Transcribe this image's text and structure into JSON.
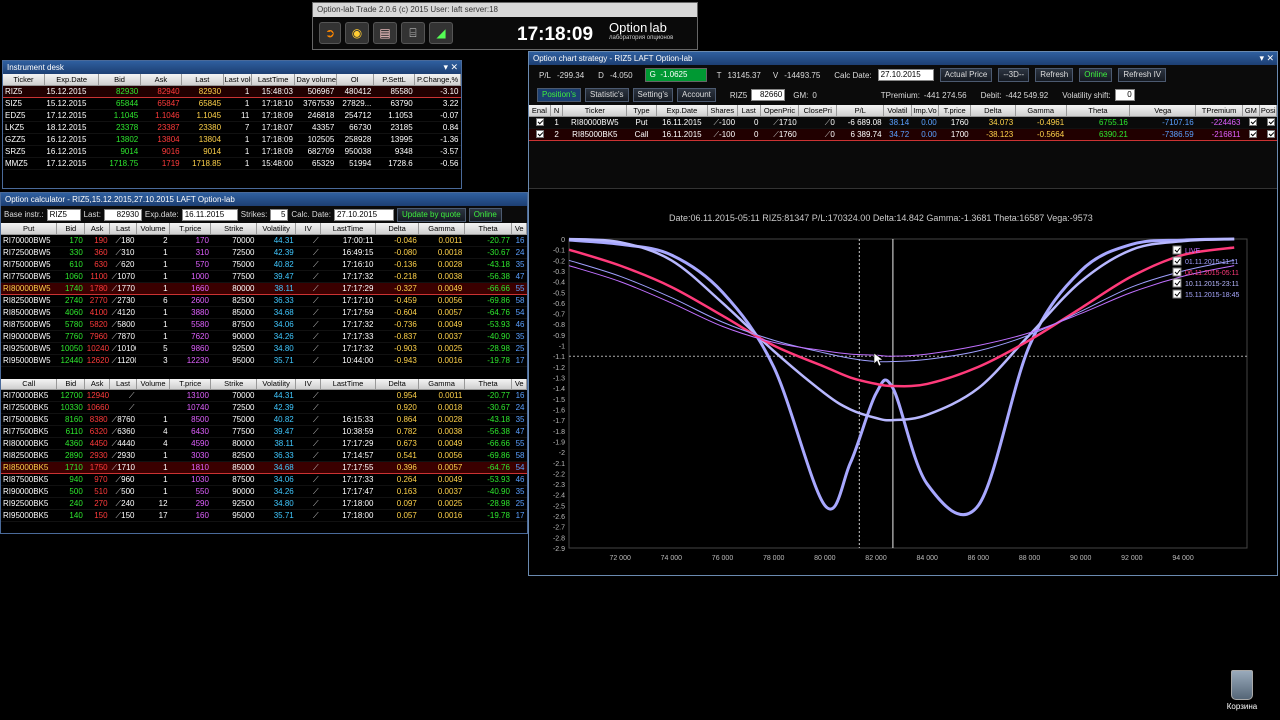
{
  "toolbar": {
    "title": "Option-lab Trade 2.0.6 (c) 2015 User: laft server:18",
    "clock": "17:18:09",
    "logo_main": "Option",
    "logo_lab": "lab",
    "logo_sub": "лаборатория опционов"
  },
  "desk": {
    "title": "Instrument desk",
    "headers": [
      "Ticker",
      "Exp.Date",
      "Bid",
      "Ask",
      "Last",
      "Last volume",
      "LastTime",
      "Day volume",
      "OI",
      "P.SettL",
      "P.Change,%"
    ],
    "rows": [
      [
        "RIZ5",
        "15.12.2015",
        "82930",
        "82940",
        "82930",
        "1",
        "15:48:03",
        "506967",
        "480412",
        "85580",
        "-3.10"
      ],
      [
        "SIZ5",
        "15.12.2015",
        "65844",
        "65847",
        "65845",
        "1",
        "17:18:10",
        "3767539",
        "27829...",
        "63790",
        "3.22"
      ],
      [
        "EDZ5",
        "17.12.2015",
        "1.1045",
        "1.1046",
        "1.1045",
        "11",
        "17:18:09",
        "246818",
        "254712",
        "1.1053",
        "-0.07"
      ],
      [
        "LKZ5",
        "18.12.2015",
        "23378",
        "23387",
        "23380",
        "7",
        "17:18:07",
        "43357",
        "66730",
        "23185",
        "0.84"
      ],
      [
        "GZZ5",
        "16.12.2015",
        "13802",
        "13804",
        "13804",
        "1",
        "17:18:09",
        "102505",
        "258928",
        "13995",
        "-1.36"
      ],
      [
        "SRZ5",
        "16.12.2015",
        "9014",
        "9016",
        "9014",
        "1",
        "17:18:09",
        "682709",
        "950038",
        "9348",
        "-3.57"
      ],
      [
        "MMZ5",
        "17.12.2015",
        "1718.75",
        "1719",
        "1718.85",
        "1",
        "15:48:00",
        "65329",
        "51994",
        "1728.6",
        "-0.56"
      ]
    ]
  },
  "calc": {
    "title": "Option calculator - RIZ5,15.12.2015,27.10.2015 LAFT Option-lab",
    "base_label": "Base instr.:",
    "base_value": "RIZ5",
    "last_label": "Last:",
    "last_value": "82930",
    "exp_label": "Exp.date:",
    "exp_value": "16.11.2015",
    "strikes_label": "Strikes:",
    "strikes_value": "5",
    "calcdate_label": "Calc. Date:",
    "calcdate_value": "27.10.2015",
    "update_btn": "Update by quote",
    "online_btn": "Online",
    "put_headers": [
      "Put",
      "Bid",
      "Ask",
      "Last",
      "Volume",
      "T.price",
      "Strike",
      "Volatility",
      "IV",
      "LastTime",
      "Delta",
      "Gamma",
      "Theta",
      "Ve"
    ],
    "put_rows": [
      [
        "RI70000BW5",
        "170",
        "190",
        "180",
        "2",
        "170",
        "70000",
        "44.31",
        "",
        "17:00:11",
        "-0.046",
        "0.0011",
        "-20.77",
        "16"
      ],
      [
        "RI72500BW5",
        "330",
        "360",
        "310",
        "1",
        "310",
        "72500",
        "42.39",
        "",
        "16:49:15",
        "-0.080",
        "0.0018",
        "-30.67",
        "24"
      ],
      [
        "RI75000BW5",
        "610",
        "630",
        "620",
        "1",
        "570",
        "75000",
        "40.82",
        "",
        "17:16:10",
        "-0.136",
        "0.0028",
        "-43.18",
        "35"
      ],
      [
        "RI77500BW5",
        "1060",
        "1100",
        "1070",
        "1",
        "1000",
        "77500",
        "39.47",
        "",
        "17:17:32",
        "-0.218",
        "0.0038",
        "-56.38",
        "47"
      ],
      [
        "RI80000BW5",
        "1740",
        "1780",
        "1770",
        "1",
        "1660",
        "80000",
        "38.11",
        "",
        "17:17:29",
        "-0.327",
        "0.0049",
        "-66.66",
        "55"
      ],
      [
        "RI82500BW5",
        "2740",
        "2770",
        "2730",
        "6",
        "2600",
        "82500",
        "36.33",
        "",
        "17:17:10",
        "-0.459",
        "0.0056",
        "-69.86",
        "58"
      ],
      [
        "RI85000BW5",
        "4060",
        "4100",
        "4120",
        "1",
        "3880",
        "85000",
        "34.68",
        "",
        "17:17:59",
        "-0.604",
        "0.0057",
        "-64.76",
        "54"
      ],
      [
        "RI87500BW5",
        "5780",
        "5820",
        "5800",
        "1",
        "5580",
        "87500",
        "34.06",
        "",
        "17:17:32",
        "-0.736",
        "0.0049",
        "-53.93",
        "46"
      ],
      [
        "RI90000BW5",
        "7760",
        "7960",
        "7870",
        "1",
        "7620",
        "90000",
        "34.26",
        "",
        "17:17:33",
        "-0.837",
        "0.0037",
        "-40.90",
        "35"
      ],
      [
        "RI92500BW5",
        "10050",
        "10240",
        "10100",
        "5",
        "9860",
        "92500",
        "34.80",
        "",
        "17:17:32",
        "-0.903",
        "0.0025",
        "-28.98",
        "25"
      ],
      [
        "RI95000BW5",
        "12440",
        "12620",
        "11200",
        "3",
        "12230",
        "95000",
        "35.71",
        "",
        "10:44:00",
        "-0.943",
        "0.0016",
        "-19.78",
        "17"
      ]
    ],
    "call_headers": [
      "Call",
      "Bid",
      "Ask",
      "Last",
      "Volume",
      "T.price",
      "Strike",
      "Volatility",
      "IV",
      "LastTime",
      "Delta",
      "Gamma",
      "Theta",
      "Ve"
    ],
    "call_rows": [
      [
        "RI70000BK5",
        "12700",
        "12940",
        "",
        "",
        "13100",
        "70000",
        "44.31",
        "",
        "",
        "0.954",
        "0.0011",
        "-20.77",
        "16"
      ],
      [
        "RI72500BK5",
        "10330",
        "10660",
        "",
        "",
        "10740",
        "72500",
        "42.39",
        "",
        "",
        "0.920",
        "0.0018",
        "-30.67",
        "24"
      ],
      [
        "RI75000BK5",
        "8160",
        "8380",
        "8760",
        "1",
        "8500",
        "75000",
        "40.82",
        "",
        "16:15:33",
        "0.864",
        "0.0028",
        "-43.18",
        "35"
      ],
      [
        "RI77500BK5",
        "6110",
        "6320",
        "6360",
        "4",
        "6430",
        "77500",
        "39.47",
        "",
        "10:38:59",
        "0.782",
        "0.0038",
        "-56.38",
        "47"
      ],
      [
        "RI80000BK5",
        "4360",
        "4450",
        "4440",
        "4",
        "4590",
        "80000",
        "38.11",
        "",
        "17:17:29",
        "0.673",
        "0.0049",
        "-66.66",
        "55"
      ],
      [
        "RI82500BK5",
        "2890",
        "2930",
        "2930",
        "1",
        "3030",
        "82500",
        "36.33",
        "",
        "17:14:57",
        "0.541",
        "0.0056",
        "-69.86",
        "58"
      ],
      [
        "RI85000BK5",
        "1710",
        "1750",
        "1710",
        "1",
        "1810",
        "85000",
        "34.68",
        "",
        "17:17:55",
        "0.396",
        "0.0057",
        "-64.76",
        "54"
      ],
      [
        "RI87500BK5",
        "940",
        "970",
        "960",
        "1",
        "1030",
        "87500",
        "34.06",
        "",
        "17:17:33",
        "0.264",
        "0.0049",
        "-53.93",
        "46"
      ],
      [
        "RI90000BK5",
        "500",
        "510",
        "500",
        "1",
        "550",
        "90000",
        "34.26",
        "",
        "17:17:47",
        "0.163",
        "0.0037",
        "-40.90",
        "35"
      ],
      [
        "RI92500BK5",
        "240",
        "270",
        "240",
        "12",
        "290",
        "92500",
        "34.80",
        "",
        "17:18:00",
        "0.097",
        "0.0025",
        "-28.98",
        "25"
      ],
      [
        "RI95000BK5",
        "140",
        "150",
        "150",
        "17",
        "160",
        "95000",
        "35.71",
        "",
        "17:18:00",
        "0.057",
        "0.0016",
        "-19.78",
        "17"
      ]
    ]
  },
  "strategy": {
    "title": "Option chart strategy - RIZ5 LAFT Option-lab",
    "pl_label": "P/L",
    "pl_value": "-299.34",
    "d_label": "D",
    "d_value": "-4.050",
    "g_label": "G",
    "g_value": "-1.0625",
    "t_label": "T",
    "t_value": "13145.37",
    "v_label": "V",
    "v_value": "-14493.75",
    "calcdate_label": "Calc Date:",
    "calcdate_value": "27.10.2015",
    "actual_price": "Actual Price",
    "dash3d": "--3D--",
    "refresh": "Refresh",
    "online": "Online",
    "refresh_iv": "Refresh IV",
    "tabs": [
      "Position's",
      "Statistic's",
      "Setting's",
      "Account"
    ],
    "instr": "RIZ5",
    "instr_price": "82660",
    "gm_label": "GM:",
    "gm_value": "0",
    "tpremium_label": "TPremium:",
    "tpremium_value": "-441 274.56",
    "debit_label": "Debit:",
    "debit_value": "-442 549.92",
    "volshift_label": "Volatility shift:",
    "volshift_value": "0",
    "headers": [
      "Enal",
      "N",
      "Ticker",
      "Type",
      "Exp.Date",
      "Shares",
      "Last",
      "OpenPric",
      "ClosePri",
      "P/L",
      "Volatil",
      "Imp.Vo",
      "T.price",
      "Delta",
      "Gamma",
      "Theta",
      "Vega",
      "TPremium",
      "GM",
      "Posi"
    ],
    "rows": [
      [
        "",
        "1",
        "RI80000BW5",
        "Put",
        "16.11.2015",
        "-100",
        "0",
        "1710",
        "0",
        "-6 689.08",
        "38.14",
        "0.00",
        "1760",
        "34.073",
        "-0.4961",
        "6755.16",
        "-7107.16",
        "-224463",
        "",
        ""
      ],
      [
        "",
        "2",
        "RI85000BK5",
        "Call",
        "16.11.2015",
        "-100",
        "0",
        "1760",
        "0",
        "6 389.74",
        "34.72",
        "0.00",
        "1700",
        "-38.123",
        "-0.5664",
        "6390.21",
        "-7386.59",
        "-216811",
        "",
        ""
      ]
    ]
  },
  "chart": {
    "info": "Date:06.11.2015-05:11   RIZ5:81347  P/L:170324.00  Delta:14.842  Gamma:-1.3681  Theta:16587  Vega:-9573",
    "legend": [
      "LIVE",
      "01.11.2015-11:11",
      "06.11.2015-05:11",
      "10.11.2015-23:11",
      "15.11.2015-18:45"
    ],
    "colors": {
      "live": "#c070ff",
      "d1": "#a0a0ff",
      "d2": "#ff3a7a",
      "d3": "#b8b8ff",
      "d4": "#a8a8ff"
    }
  },
  "chart_data": {
    "type": "line",
    "title": "",
    "xlabel": "",
    "ylabel": "",
    "x": [
      70000,
      72000,
      74000,
      76000,
      78000,
      80000,
      81000,
      82000,
      82660,
      84000,
      86000,
      88000,
      90000,
      92000,
      94000,
      96000
    ],
    "xticks": [
      "72 000",
      "74 000",
      "76 000",
      "78 000",
      "80 000",
      "82 000",
      "84 000",
      "86 000",
      "88 000",
      "90 000",
      "92 000",
      "94 000"
    ],
    "yticks": [
      "0",
      "-0.1",
      "-0.2",
      "-0.3",
      "-0.4",
      "-0.5",
      "-0.6",
      "-0.7",
      "-0.8",
      "-0.9",
      "-1",
      "-1.1",
      "-1.2",
      "-1.3",
      "-1.4",
      "-1.5",
      "-1.6",
      "-1.7",
      "-1.8",
      "-1.9",
      "-2",
      "-2.1",
      "-2.2",
      "-2.3",
      "-2.4",
      "-2.5",
      "-2.6",
      "-2.7",
      "-2.8",
      "-2.9"
    ],
    "ylim": [
      -2.9,
      0
    ],
    "xlim": [
      70000,
      96500
    ],
    "series": [
      {
        "name": "15.11.2015-18:45",
        "values": [
          -0.01,
          -0.05,
          -0.15,
          -0.5,
          -1.2,
          -2.5,
          -2.1,
          -1.45,
          -1.4,
          -2.3,
          -2.5,
          -1.0,
          -0.3,
          -0.05,
          -0.01,
          0.0
        ]
      },
      {
        "name": "10.11.2015-23:11",
        "values": [
          -0.0,
          -0.03,
          -0.2,
          -0.6,
          -1.05,
          -1.45,
          -1.6,
          -1.68,
          -1.7,
          -1.65,
          -1.4,
          -0.9,
          -0.4,
          -0.1,
          -0.02,
          0.0
        ]
      },
      {
        "name": "06.11.2015-05:11",
        "values": [
          -0.1,
          -0.25,
          -0.45,
          -0.72,
          -1.0,
          -1.2,
          -1.3,
          -1.36,
          -1.38,
          -1.36,
          -1.2,
          -0.95,
          -0.65,
          -0.35,
          -0.15,
          -0.08
        ]
      },
      {
        "name": "01.11.2015-11:11",
        "values": [
          -0.2,
          -0.35,
          -0.55,
          -0.78,
          -0.95,
          -1.07,
          -1.12,
          -1.15,
          -1.15,
          -1.13,
          -1.05,
          -0.9,
          -0.68,
          -0.45,
          -0.3,
          -0.2
        ]
      },
      {
        "name": "LIVE",
        "values": [
          -0.25,
          -0.4,
          -0.6,
          -0.82,
          -0.97,
          -1.05,
          -1.08,
          -1.09,
          -1.1,
          -1.08,
          -1.0,
          -0.88,
          -0.7,
          -0.5,
          -0.35,
          -0.25
        ]
      }
    ]
  },
  "desktop": {
    "recycle": "Корзина"
  }
}
